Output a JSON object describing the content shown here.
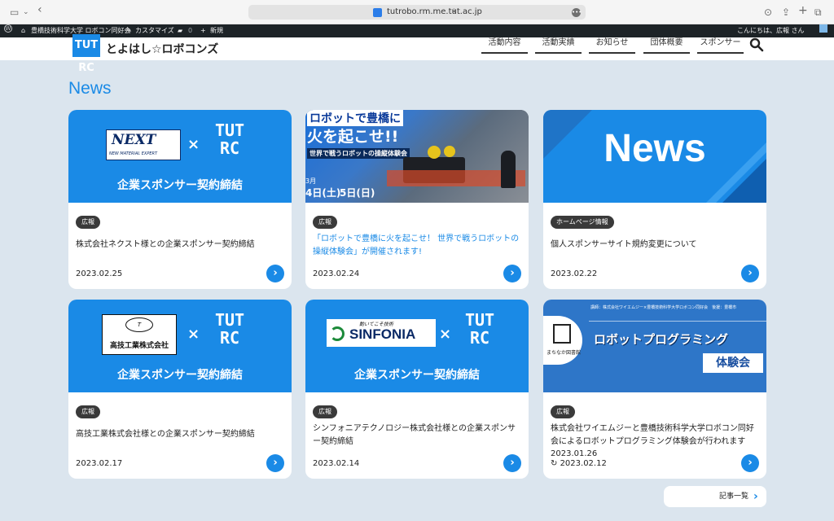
{
  "browser": {
    "url": "tutrobo.rm.me.tut.ac.jp"
  },
  "admin_bar": {
    "site_name": "豊橋技術科学大学 ロボコン同好会",
    "customize": "カスタマイズ",
    "comments": "0",
    "new": "新規",
    "greeting": "こんにちは、広報 さん"
  },
  "header": {
    "logo_text": "TUT RC",
    "site_title": "とよはし☆ロボコンズ",
    "nav": [
      "活動内容",
      "活動実績",
      "お知らせ",
      "団体概要",
      "スポンサー"
    ]
  },
  "news": {
    "heading": "News",
    "cards": [
      {
        "badge": "広報",
        "title": "株式会社ネクスト様との企業スポンサー契約締結",
        "date": "2023.02.25",
        "thumb_caption": "企業スポンサー契約締結",
        "thumb_logo": "NEXT",
        "thumb_logo_sub": "NEW MATERIAL EXPERT"
      },
      {
        "badge": "広報",
        "title": "「ロボットで豊橋に火を起こせ！ 世界で戦うロボットの操縦体験会」が開催されます!",
        "date": "2023.02.24",
        "thumb_line1": "ロボットで豊橋に",
        "thumb_line2": "火を起こせ!!",
        "thumb_line3": "世界で戦うロボットの操縦体験会",
        "thumb_month": "3月",
        "thumb_day1": "4日(土)",
        "thumb_day2": "5日(日)"
      },
      {
        "badge": "ホームページ情報",
        "title": "個人スポンサーサイト規約変更について",
        "date": "2023.02.22",
        "thumb_text": "News"
      },
      {
        "badge": "広報",
        "title": "高技工業株式会社様との企業スポンサー契約締結",
        "date": "2023.02.17",
        "thumb_caption": "企業スポンサー契約締結",
        "thumb_logo": "高技工業株式会社"
      },
      {
        "badge": "広報",
        "title": "シンフォニアテクノロジー株式会社様との企業スポンサー契約締結",
        "date": "2023.02.14",
        "thumb_caption": "企業スポンサー契約締結",
        "thumb_logo": "SINFONIA",
        "thumb_logo_sub": "動いてこそ技術"
      },
      {
        "badge": "広報",
        "title": "株式会社ワイエムジーと豊橋技術科学大学ロボコン同好会によるロボットプログラミング体験会が行われます",
        "date": "2023.01.26",
        "updated": "2023.02.12",
        "thumb_top": "講師：株式会社ワイエムジー×豊橋技術科学大学ロボコン同好会　後援：豊橋市",
        "thumb_main": "ロボットプログラミング",
        "thumb_sub": "体験会",
        "thumb_lib": "まちなか図書館"
      }
    ]
  },
  "more_link": "記事一覧",
  "tut_mark": "TUT\nRC"
}
